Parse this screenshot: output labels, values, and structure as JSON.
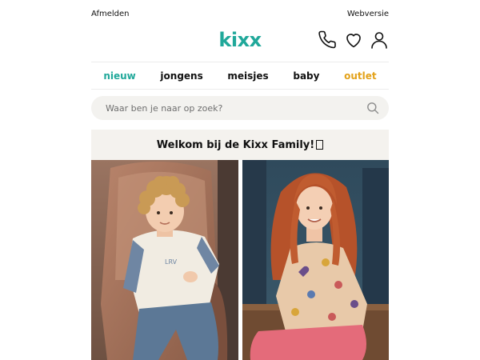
{
  "topbar": {
    "logout_label": "Afmelden",
    "web_version_label": "Webversie"
  },
  "header": {
    "logo_text": "kixx",
    "brand_color": "#20a89a",
    "icons": [
      "phone-icon",
      "heart-icon",
      "user-icon"
    ]
  },
  "nav": {
    "items": [
      {
        "label": "nieuw",
        "color": "#20a89a"
      },
      {
        "label": "jongens",
        "color": "#111111"
      },
      {
        "label": "meisjes",
        "color": "#111111"
      },
      {
        "label": "baby",
        "color": "#111111"
      },
      {
        "label": "outlet",
        "color": "#e3a21a"
      }
    ]
  },
  "search": {
    "placeholder": "Waar ben je naar op zoek?",
    "value": ""
  },
  "welcome": {
    "text": "Welkom bij de Kixx Family!"
  },
  "images": [
    {
      "subject": "boy-in-cream-sweater-on-chair"
    },
    {
      "subject": "red-haired-girl-in-heart-print-sweater"
    }
  ]
}
